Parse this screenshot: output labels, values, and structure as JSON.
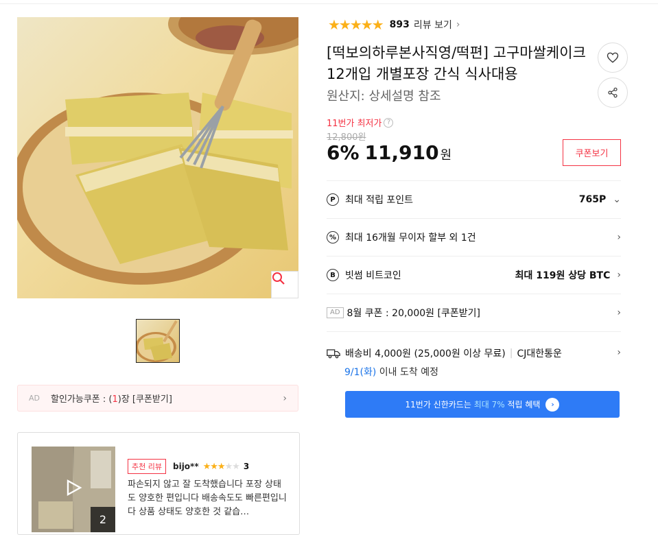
{
  "rating": {
    "stars": "★★★★★",
    "count": "893",
    "link_label": "리뷰 보기",
    "chevron": "›"
  },
  "product": {
    "title": "[떡보의하루본사직영/떡편] 고구마쌀케이크 12개입 개별포장 간식 식사대용",
    "origin": "원산지:  상세설명 참조"
  },
  "price": {
    "lowest_label": "11번가 최저가",
    "help": "?",
    "original": "12,800원",
    "discount": "6%",
    "sale": "11,910",
    "unit": "원",
    "coupon_button": "쿠폰보기"
  },
  "benefits": [
    {
      "icon": "P",
      "label": "최대 적립 포인트",
      "value": "765P",
      "chevron": "⌄"
    },
    {
      "icon": "%",
      "label": "최대 16개월 무이자 할부 외 1건",
      "value": "",
      "chevron": "›"
    },
    {
      "icon": "B",
      "label": "빗썸 비트코인",
      "value": "최대 119원 상당 BTC",
      "chevron": "›"
    },
    {
      "ad": "AD",
      "label": "8월 쿠폰 : 20,000원 [쿠폰받기]",
      "chevron": "›"
    }
  ],
  "shipping": {
    "fee": "배송비 4,000원 (25,000원 이상 무료)",
    "separator": "|",
    "carrier": "CJ대한통운",
    "date": "9/1(화)",
    "date_suffix": "이내 도착 예정",
    "chevron": "›"
  },
  "card_banner": {
    "prefix": "11번가 신한카드는",
    "highlight": "최대 7%",
    "suffix": "적립 혜택",
    "arrow": "›"
  },
  "left": {
    "coupon_bar": {
      "ad": "AD",
      "text_before": "할인가능쿠폰 : (",
      "count": "1",
      "text_after": ")장 [쿠폰받기]",
      "chevron": "›"
    }
  },
  "review": {
    "badge": "추천 리뷰",
    "user": "bijo**",
    "stars_on": "★★★",
    "stars_off": "★★",
    "score": "3",
    "media_count": "2",
    "text": "파손되지 않고 잘 도착했습니다 포장 상태도 양호한 편입니다 배송속도도 빠른편입니다 상품 상태도 양호한 것 같습…"
  },
  "colors": {
    "accent_red": "#f43142",
    "star": "#fbb018",
    "banner_blue": "#2e7bf6",
    "date_blue": "#1a73e8"
  },
  "icons": [
    "search-icon",
    "heart-icon",
    "share-icon",
    "truck-icon",
    "play-icon",
    "chevron-right-icon"
  ]
}
